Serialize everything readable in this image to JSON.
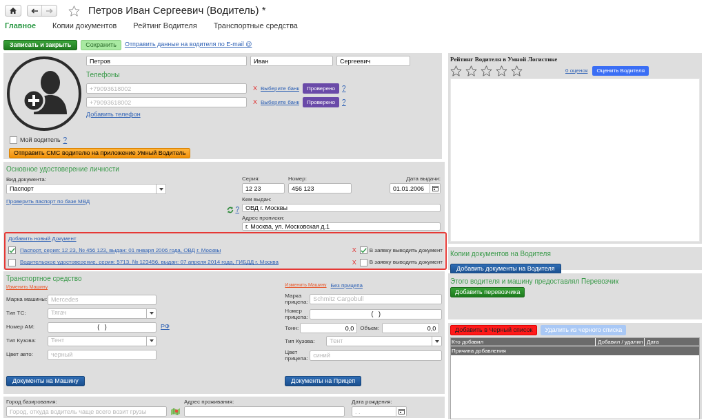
{
  "header": {
    "title": "Петров Иван Сергеевич (Водитель) *",
    "favorite": false
  },
  "tabs": [
    {
      "label": "Главное",
      "selected": true
    },
    {
      "label": "Копии документов",
      "selected": false
    },
    {
      "label": "Рейтинг Водителя",
      "selected": false
    },
    {
      "label": "Транспортные средства",
      "selected": false
    }
  ],
  "toolbar": {
    "save_close": "Записать и закрыть",
    "save": "Сохранить",
    "email_link": "Отправить данные на водителя по E-mail @"
  },
  "person": {
    "last_name": "Петров",
    "first_name": "Иван",
    "middle_name": "Сергеевич",
    "phones_title": "Телефоны",
    "phones": [
      {
        "placeholder": "+79093618002",
        "remove": "X",
        "bank_link": "Выберите банк",
        "verified": "Проверено",
        "help": "?"
      },
      {
        "placeholder": "+79093618002",
        "remove": "X",
        "bank_link": "Выберите банк",
        "verified": "Проверено",
        "help": "?"
      }
    ],
    "add_phone": "Добавить телефон",
    "my_driver": {
      "label": "Мой водитель",
      "checked": false,
      "help": "?"
    },
    "sms_button": "Отправить СМС водителю на приложение Умный Водитель"
  },
  "identity": {
    "title": "Основное удостоверение личности",
    "doc_type_label": "Вид документа:",
    "doc_type": "Паспорт",
    "check_link": "Проверить паспорт по базе МВД",
    "series_label": "Серия:",
    "series": "12 23",
    "number_label": "Номер:",
    "number": "456 123",
    "date_label": "Дата выдачи:",
    "date": "01.01.2006",
    "help": "?",
    "issued_by_label": "Кем выдан:",
    "issued_by": "ОВД г. Москвы",
    "address_label": "Адрес прописки:",
    "address": "г. Москва, ул. Московская д.1"
  },
  "documents": {
    "add_link": "Добавить новый Документ",
    "items": [
      {
        "checked": true,
        "text": "Паспорт, серия: 12 23, № 456 123, выдан: 01 января 2006 года, ОВД г. Москвы",
        "remove": "X",
        "include": true,
        "include_label": "В заявку выводить документ"
      },
      {
        "checked": false,
        "text": "Водительское удостоверение, серия: 5713, № 123456, выдан: 07 апреля 2014 года, ГИБДД г. Москва",
        "remove": "X",
        "include": false,
        "include_label": "В заявку выводить документ"
      }
    ]
  },
  "vehicle": {
    "title": "Транспортное средство",
    "change_link": "Изменить Машину",
    "rows": [
      {
        "kind": "text",
        "label": "Марка машины:",
        "placeholder": "Mercedes"
      },
      {
        "kind": "select",
        "label": "Тип ТС:",
        "placeholder": "Тягач"
      },
      {
        "kind": "number",
        "label": "Номер АМ:",
        "value": "(   )",
        "link": "РФ"
      },
      {
        "kind": "select",
        "label": "Тип Кузова:",
        "placeholder": "Тент"
      },
      {
        "kind": "text",
        "label": "Цвет авто:",
        "placeholder": "черный"
      }
    ],
    "docs_button": "Документы на Машину"
  },
  "trailer": {
    "change_link": "Изменить Машину",
    "no_trailer_link": "Без прицепа",
    "rows": [
      {
        "kind": "text",
        "label": "Марка прицепа:",
        "placeholder": "Schmitz Cargobull"
      },
      {
        "kind": "text",
        "label": "Номер прицепа:",
        "value": "(   )"
      },
      {
        "kind": "pair",
        "label": "Тонн:",
        "value": "0,0",
        "label2": "Объем:",
        "value2": "0,0"
      },
      {
        "kind": "select",
        "label": "Тип Кузова:",
        "placeholder": "Тент"
      },
      {
        "kind": "text",
        "label": "Цвет прицепа:",
        "placeholder": "синий"
      }
    ],
    "docs_button": "Документы на Прицеп"
  },
  "rating": {
    "title": "Рейтинг Водителя в Умной Логистике",
    "stars": 0,
    "count_link": "0 оценок",
    "rate_button": "Оценить Водителя"
  },
  "copies": {
    "title": "Копии документов на Водителя",
    "button": "Добавить документы на Водителя"
  },
  "carrier": {
    "title": "Этого водителя и машину предоставлял Перевозчик",
    "button": "Добавить перевозчика"
  },
  "blacklist": {
    "add_button": "Добавить в Черный список",
    "remove_button": "Удалить из черного списка",
    "remove_disabled": true,
    "columns": [
      "Кто добавил",
      "Добавил / удалил",
      "Дата"
    ],
    "subheader": "Причина добавления"
  },
  "bottom": {
    "city_label": "Город базирования:",
    "city_placeholder": "Город, откуда водитель чаще всего возит грузы",
    "address_label": "Адрес проживания:",
    "birth_label": "Дата рождения:",
    "birth_placeholder": ". ."
  }
}
